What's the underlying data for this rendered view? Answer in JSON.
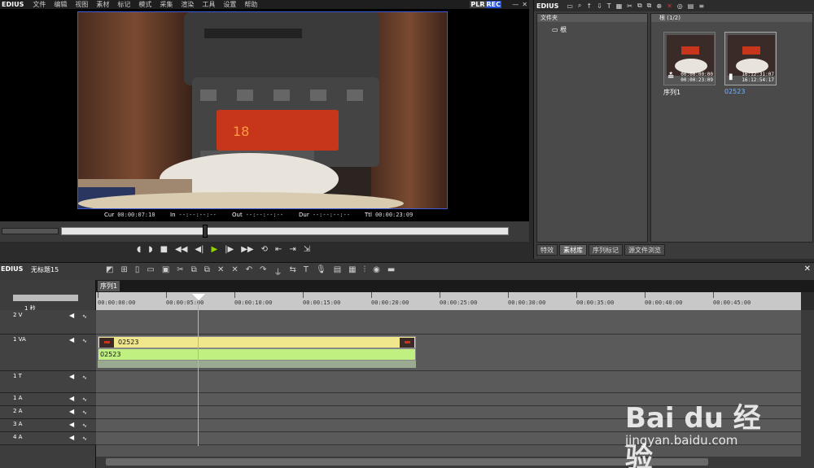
{
  "app": {
    "logo": "EDIUS"
  },
  "menu": [
    "文件",
    "编辑",
    "视图",
    "素材",
    "标记",
    "模式",
    "采集",
    "渲染",
    "工具",
    "设置",
    "帮助"
  ],
  "player": {
    "mode_plr": "PLR",
    "mode_rec": "REC",
    "cur_label": "Cur",
    "cur_value": "00:00:07:10",
    "in_label": "In",
    "in_value": "--:--:--:--",
    "out_label": "Out",
    "out_value": "--:--:--:--",
    "dur_label": "Dur",
    "dur_value": "--:--:--:--",
    "ttl_label": "Ttl",
    "ttl_value": "00:00:23:09",
    "scrub_position_fraction": 0.32
  },
  "bin": {
    "logo": "EDIUS",
    "folder_header": "文件夹",
    "folder_root": "根",
    "clip_header": "根 (1/2)",
    "clips": [
      {
        "name": "序列1",
        "tc_top": "00:00:00:00",
        "tc_bottom": "00:00:23:09",
        "selected": false
      },
      {
        "name": "02523",
        "tc_top": "16:12:31:07",
        "tc_bottom": "16:12:54:17",
        "selected": true
      }
    ],
    "tabs": [
      "特效",
      "素材库",
      "序列标记",
      "源文件浏览"
    ],
    "active_tab": 1
  },
  "timeline": {
    "logo": "EDIUS",
    "project_name": "无标题15",
    "sequence_tab": "序列1",
    "zoom_label": "1 秒",
    "ruler": [
      "00:00:00:00",
      "00:00:05:00",
      "00:00:10:00",
      "00:00:15:00",
      "00:00:20:00",
      "00:00:25:00",
      "00:00:30:00",
      "00:00:35:00",
      "00:00:40:00",
      "00:00:45:00"
    ],
    "tracks": [
      {
        "name": "2 V"
      },
      {
        "name": "1 VA"
      },
      {
        "name": "1 T"
      },
      {
        "name": "1 A"
      },
      {
        "name": "2 A"
      },
      {
        "name": "3 A"
      },
      {
        "name": "4 A"
      }
    ],
    "video_clip_label": "02523",
    "audio_clip_label": "02523"
  },
  "watermark": {
    "brand": "Bai du 经验",
    "url": "jingyan.baidu.com"
  }
}
